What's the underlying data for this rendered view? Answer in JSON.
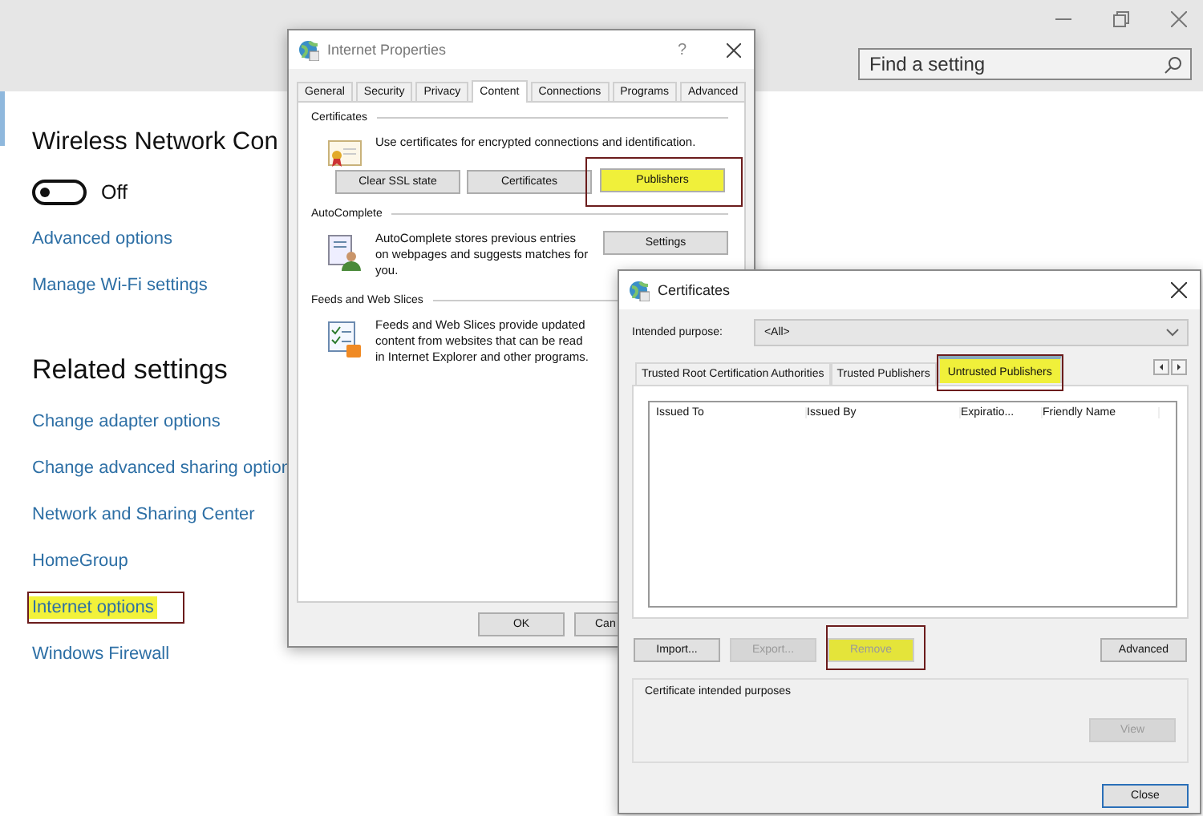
{
  "settings": {
    "search": {
      "placeholder": "Find a setting"
    },
    "heading": "Wireless Network Con",
    "wifi_toggle": {
      "on": false,
      "label": "Off"
    },
    "links": [
      {
        "label": "Advanced options",
        "highlighted": false
      },
      {
        "label": "Manage Wi-Fi settings",
        "highlighted": false
      }
    ],
    "related_heading": "Related settings",
    "related_links": [
      {
        "label": "Change adapter options",
        "highlighted": false
      },
      {
        "label": "Change advanced sharing option",
        "highlighted": false
      },
      {
        "label": "Network and Sharing Center",
        "highlighted": false
      },
      {
        "label": "HomeGroup",
        "highlighted": false
      },
      {
        "label": "Internet options",
        "highlighted": true
      },
      {
        "label": "Windows Firewall",
        "highlighted": false
      }
    ]
  },
  "internet_properties": {
    "title": "Internet Properties",
    "help": "?",
    "tabs": [
      {
        "label": "General",
        "selected": false
      },
      {
        "label": "Security",
        "selected": false
      },
      {
        "label": "Privacy",
        "selected": false
      },
      {
        "label": "Content",
        "selected": true
      },
      {
        "label": "Connections",
        "selected": false
      },
      {
        "label": "Programs",
        "selected": false
      },
      {
        "label": "Advanced",
        "selected": false
      }
    ],
    "sections": [
      {
        "kind": "certificates",
        "title": "Certificates",
        "text": "Use certificates for encrypted connections and identification.",
        "buttons": [
          {
            "label": "Clear SSL state",
            "highlighted": false
          },
          {
            "label": "Certificates",
            "highlighted": false
          },
          {
            "label": "Publishers",
            "highlighted": true
          }
        ]
      },
      {
        "kind": "autocomplete",
        "title": "AutoComplete",
        "text": "AutoComplete stores previous entries on webpages and suggests matches for you.",
        "buttons": [
          {
            "label": "Settings",
            "highlighted": false
          }
        ]
      },
      {
        "kind": "feeds",
        "title": "Feeds and Web Slices",
        "text": "Feeds and Web Slices provide updated content from websites that can be read in Internet Explorer and other programs."
      }
    ],
    "footer_buttons": [
      "OK",
      "Can"
    ]
  },
  "certificates": {
    "title": "Certificates",
    "purpose_label": "Intended purpose:",
    "purpose_value": "<All>",
    "tabs": [
      {
        "label": "Trusted Root Certification Authorities",
        "selected": false,
        "highlighted": false
      },
      {
        "label": "Trusted Publishers",
        "selected": false,
        "highlighted": false
      },
      {
        "label": "Untrusted Publishers",
        "selected": true,
        "highlighted": true
      }
    ],
    "columns": [
      "Issued To",
      "Issued By",
      "Expiratio...",
      "Friendly Name"
    ],
    "buttons": [
      {
        "label": "Import...",
        "disabled": false,
        "highlighted": false
      },
      {
        "label": "Export...",
        "disabled": true,
        "highlighted": false
      },
      {
        "label": "Remove",
        "disabled": true,
        "highlighted": true
      }
    ],
    "advanced_button": "Advanced",
    "group_label": "Certificate intended purposes",
    "view_button": {
      "label": "View",
      "disabled": true
    },
    "close_button": "Close"
  }
}
